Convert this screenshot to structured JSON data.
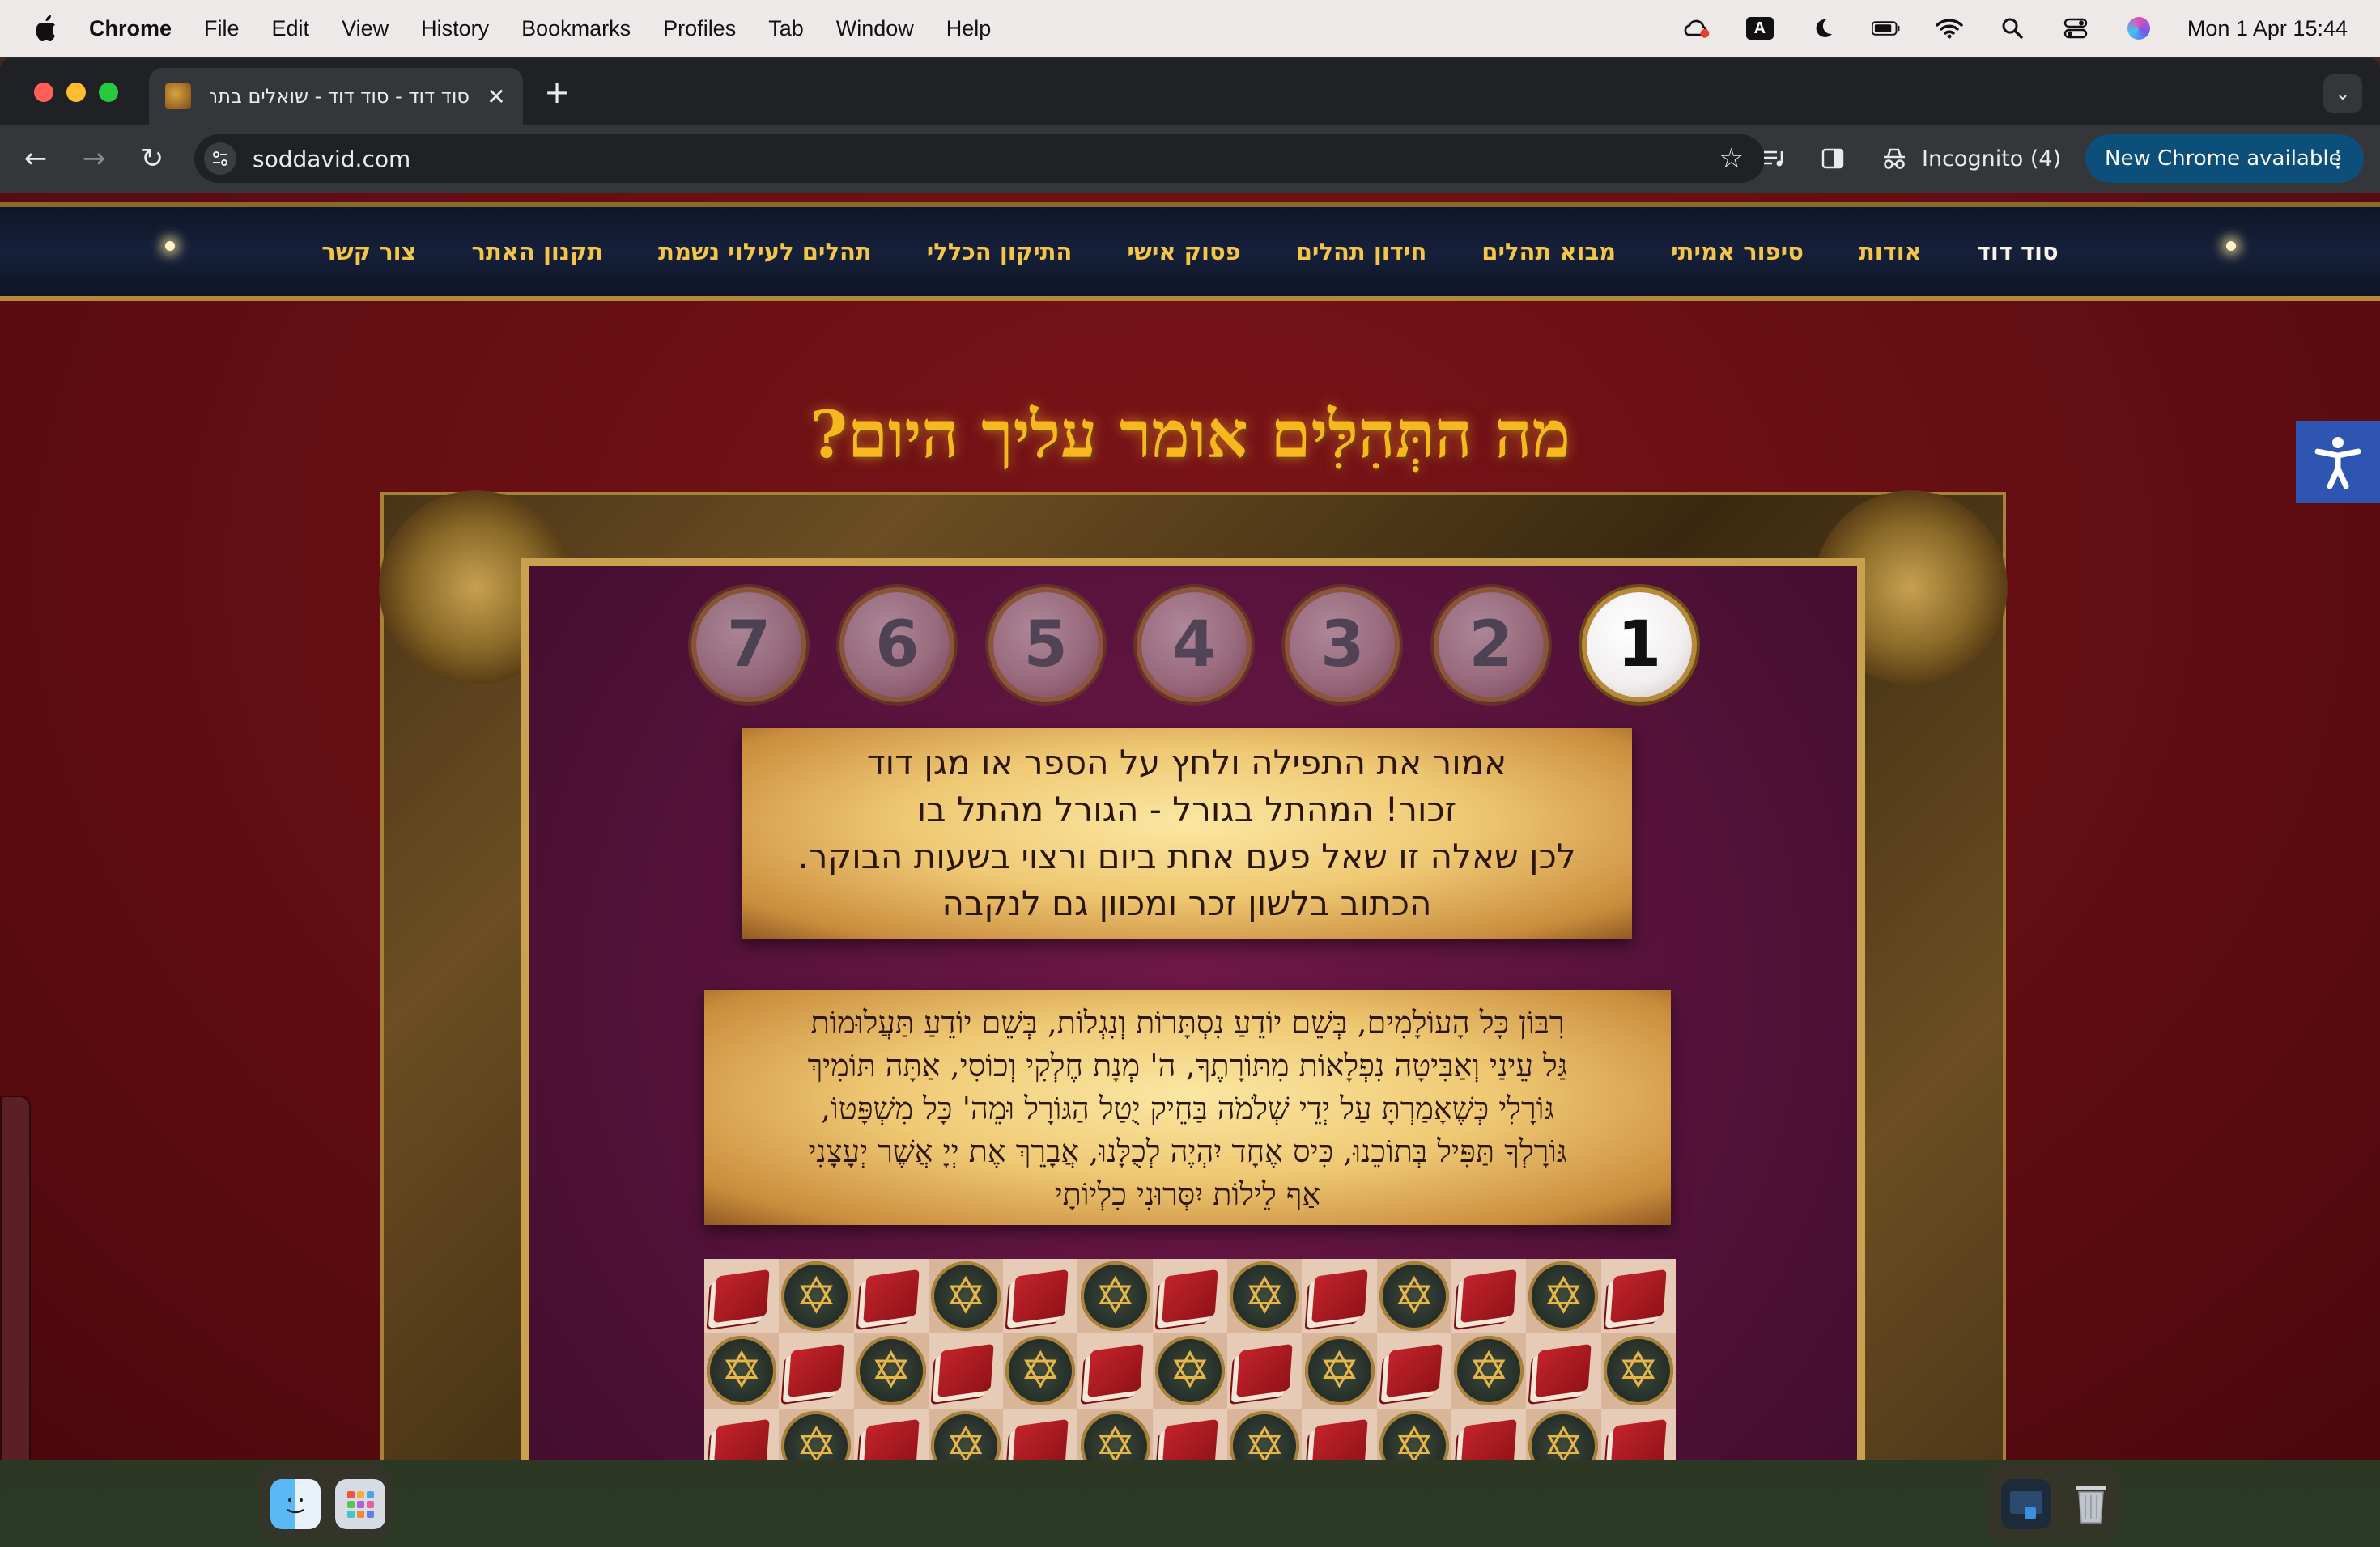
{
  "menubar": {
    "app": "Chrome",
    "items": [
      "File",
      "Edit",
      "View",
      "History",
      "Bookmarks",
      "Profiles",
      "Tab",
      "Window",
      "Help"
    ],
    "clock": "Mon 1 Apr  15:44",
    "keyboard_indicator": "A"
  },
  "browser": {
    "tab_title": "סוד דוד - סוד דוד - שואלים בתהלים",
    "url": "soddavid.com",
    "incognito_label": "Incognito (4)",
    "update_label": "New Chrome available"
  },
  "site": {
    "nav": [
      "סוד דוד",
      "אודות",
      "סיפור אמיתי",
      "מבוא תהלים",
      "חידון תהלים",
      "פסוק אישי",
      "התיקון הכללי",
      "תהלים לעילוי נשמת",
      "תקנון האתר",
      "צור קשר"
    ],
    "title": "מה התְּהִלִּים אומר עליך היום?",
    "balls": [
      "1",
      "2",
      "3",
      "4",
      "5",
      "6",
      "7"
    ],
    "active_ball": 1,
    "instructions": [
      "אמור את התפילה ולחץ על הספר או מגן דוד",
      "זכור! המהתל בגורל - הגורל מהתל בו",
      "לכן שאלה זו שאל פעם אחת ביום ורצוי בשעות הבוקר.",
      "הכתוב בלשון זכר ומכוון גם לנקבה"
    ],
    "prayer": [
      "רִבּוֹן כָּל הָעוֹלָמִים, בְּשֵׁם יוֹדֵעַ נִסְתָּרוֹת וְנִגְלוֹת, בְּשֵׁם יוֹדֵעַ תַּעֲלוּמוֹת",
      "גַּל עֵינַי וְאַבִּיטָה נִפְלָאוֹת מִתּוֹרָתֶךָ, ה' מְנָת חֶלְקִי וְכוֹסִי, אַתָּה תּוֹמִיךְ",
      "גּוֹרָלִי כְּשֶׁאָמַרְתָּ עַל יְדֵי שְׁלֹמֹה בַּחֵיק יֻטַל הַגּוֹרָל וּמֵה' כָּל מִשְׁפָּטוֹ,",
      "גּוֹרָלְךָ תַּפִּיל בְּתוֹכֵנוּ, כִּיס אֶחָד יִהְיֶה לְכֻלָּנוּ, אֲבָרֵךְ אֶת יְיָ אֲשֶׁר יְעָצָנִי",
      "אַף לֵילוֹת יִסְּרוּנִי כִלְיוֹתָי"
    ],
    "grid_rows": [
      [
        "book",
        "star",
        "book",
        "star",
        "book",
        "star",
        "book",
        "star",
        "book",
        "star",
        "book",
        "star",
        "book"
      ],
      [
        "star",
        "book",
        "star",
        "book",
        "star",
        "book",
        "star",
        "book",
        "star",
        "book",
        "star",
        "book",
        "star"
      ],
      [
        "book",
        "star",
        "book",
        "star",
        "book",
        "star",
        "book",
        "star",
        "book",
        "star",
        "book",
        "star",
        "book"
      ]
    ]
  },
  "colors": {
    "page_bg": "#6b0f12",
    "nav_bg": "#16203a",
    "nav_text": "#f3c649",
    "title": "#f6b81e",
    "accessibility": "#2f55b3",
    "update_button": "#0b4f7a"
  }
}
